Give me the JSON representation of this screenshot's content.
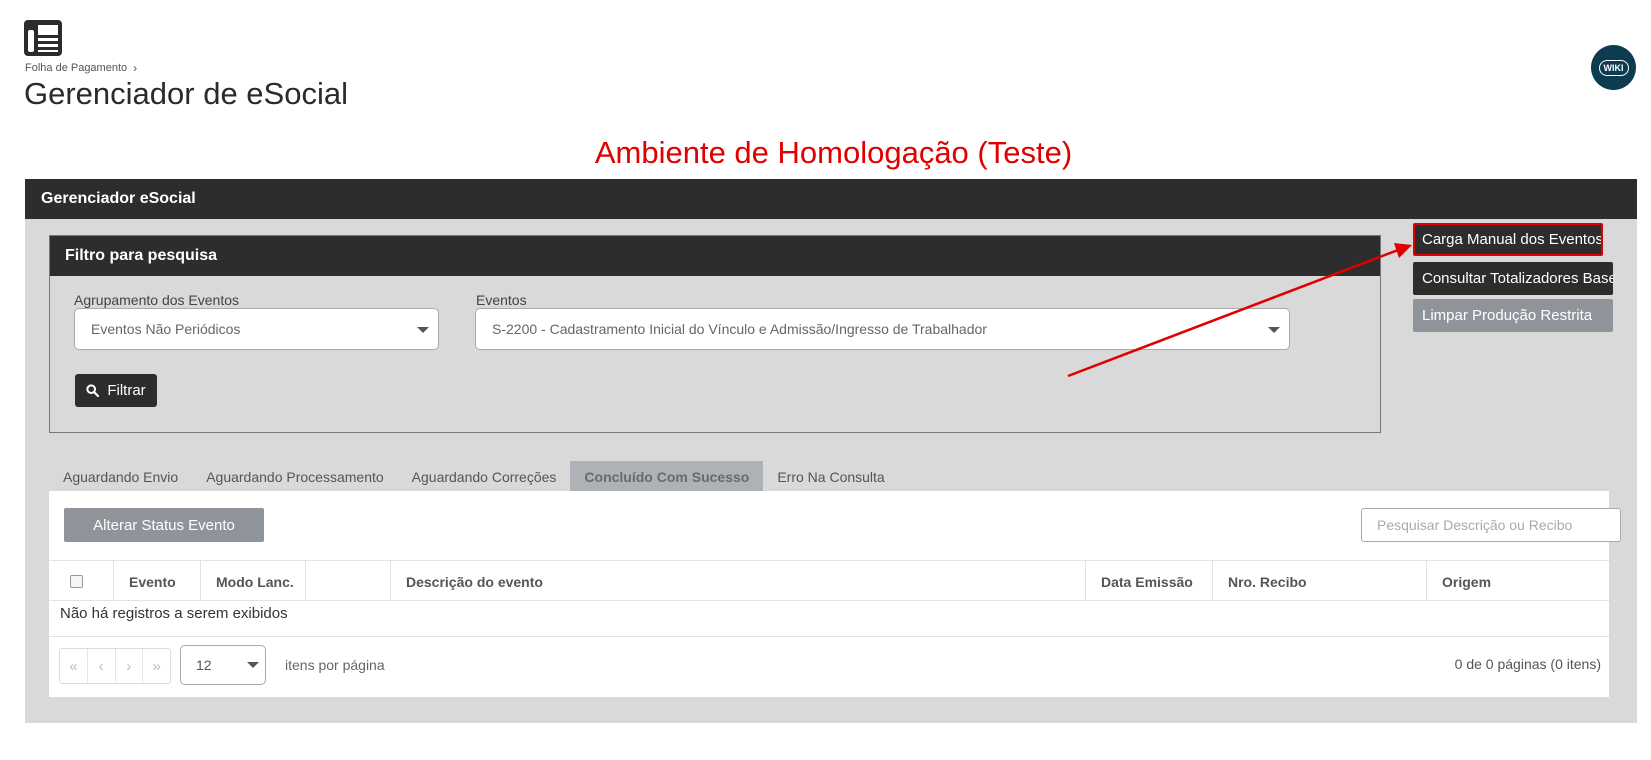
{
  "header": {
    "breadcrumb": "Folha de Pagamento",
    "title": "Gerenciador de eSocial",
    "wiki_label": "WIKI"
  },
  "env_banner": "Ambiente de Homologação (Teste)",
  "main": {
    "title": "Gerenciador eSocial",
    "filter": {
      "title": "Filtro para pesquisa",
      "group_label": "Agrupamento dos Eventos",
      "group_value": "Eventos Não Periódicos",
      "events_label": "Eventos",
      "events_value": "S-2200 - Cadastramento Inicial do Vínculo e Admissão/Ingresso de Trabalhador",
      "filter_button": "Filtrar"
    },
    "side_buttons": [
      {
        "label": "Carga Manual dos Eventos"
      },
      {
        "label": "Consultar Totalizadores Base"
      },
      {
        "label": "Limpar Produção Restrita"
      }
    ],
    "tabs": [
      {
        "label": "Aguardando Envio"
      },
      {
        "label": "Aguardando Processamento"
      },
      {
        "label": "Aguardando Correções"
      },
      {
        "label": "Concluído Com Sucesso",
        "active": true
      },
      {
        "label": "Erro Na Consulta"
      }
    ],
    "grid": {
      "alter_status_button": "Alterar Status Evento",
      "search_placeholder": "Pesquisar Descrição ou Recibo",
      "columns": [
        "Evento",
        "Modo Lanc.",
        "",
        "Descrição do evento",
        "Data Emissão",
        "Nro. Recibo",
        "Origem"
      ],
      "empty_message": "Não há registros a serem exibidos",
      "page_size": "12",
      "per_page_label": "itens por página",
      "page_info": "0 de 0 páginas (0 itens)"
    }
  },
  "colors": {
    "header_dark": "#2d2d2d",
    "banner_red": "#e00000",
    "panel_gray": "#d9d9d9",
    "button_gray": "#8f949a"
  }
}
